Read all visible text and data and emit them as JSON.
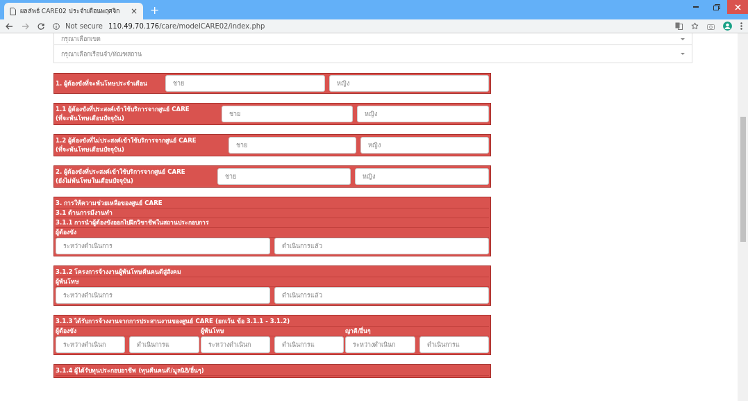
{
  "browser": {
    "tab_title": "ผลลัพธ์ CARE02 ประจำเดือนพฤศจิก",
    "tab_close": "×",
    "new_tab": "+",
    "security_label": "Not secure",
    "url_host": "110.49.70.176",
    "url_path": "/care/modelCARE02/index.php"
  },
  "filters": [
    {
      "placeholder": "กรุณาเลือกเขต"
    },
    {
      "placeholder": "กรุณาเลือกเรือนจำ/ทัณฑสถาน"
    }
  ],
  "sections": [
    {
      "kind": "inline",
      "title": [
        "1. ผู้ต้องขังที่จะพ้นโทษประจำเดือน"
      ],
      "fields": [
        {
          "placeholder": "ชาย"
        },
        {
          "placeholder": "หญิง"
        }
      ]
    },
    {
      "kind": "inline",
      "title": [
        "1.1 ผู้ต้องขังที่ประสงค์เข้าใช้บริการจากศูนย์ CARE",
        "(ที่จะพ้นโทษเดือนปัจจุบัน)"
      ],
      "fields": [
        {
          "placeholder": "ชาย"
        },
        {
          "placeholder": "หญิง"
        }
      ]
    },
    {
      "kind": "inline",
      "title": [
        "1.2 ผู้ต้องขังที่ไม่ประสงค์เข้าใช้บริการจากศูนย์ CARE",
        "(ที่จะพ้นโทษเดือนปัจจุบัน)"
      ],
      "fields": [
        {
          "placeholder": "ชาย"
        },
        {
          "placeholder": "หญิง"
        }
      ]
    },
    {
      "kind": "inline",
      "title": [
        "2. ผู้ต้องขังที่ประสงค์เข้าใช้บริการจากศูนย์ CARE",
        "(ยังไม่พ้นโทษในเดือนปัจจุบัน)"
      ],
      "fields": [
        {
          "placeholder": "ชาย"
        },
        {
          "placeholder": "หญิง"
        }
      ]
    },
    {
      "kind": "stacked",
      "headings": [
        "3. การให้ความช่วยเหลือของศูนย์ CARE",
        "3.1 ด้านการมีงานทำ",
        "3.1.1 การนำผู้ต้องขังออกไปฝึกวิชาชีพในสถานประกอบการ"
      ],
      "groups": [
        {
          "label": "ผู้ต้องขัง",
          "fields": [
            {
              "placeholder": "ระหว่างดำเนินการ"
            },
            {
              "placeholder": "ดำเนินการแล้ว"
            }
          ]
        }
      ]
    },
    {
      "kind": "stacked",
      "headings": [
        "3.1.2 โครงการจ้างงานผู้พ้นโทษคืนคนดีสู่สังคม"
      ],
      "groups": [
        {
          "label": "ผู้พ้นโทษ",
          "fields": [
            {
              "placeholder": "ระหว่างดำเนินการ"
            },
            {
              "placeholder": "ดำเนินการแล้ว"
            }
          ]
        }
      ]
    },
    {
      "kind": "stacked",
      "headings": [
        "3.1.3 ได้รับการจ้างงานจากการประสานงานของศูนย์ CARE (ยกเว้น ข้อ 3.1.1 - 3.1.2)"
      ],
      "groups": [
        {
          "label": "ผู้ต้องขัง",
          "fields": [
            {
              "placeholder": "ระหว่างดำเนินก"
            },
            {
              "placeholder": "ดำเนินการแ"
            }
          ]
        },
        {
          "label": "ผู้พ้นโทษ",
          "fields": [
            {
              "placeholder": "ระหว่างดำเนินก"
            },
            {
              "placeholder": "ดำเนินการแ"
            }
          ]
        },
        {
          "label": "ญาติ/อื่นๆ",
          "fields": [
            {
              "placeholder": "ระหว่างดำเนินก"
            },
            {
              "placeholder": "ดำเนินการแ"
            }
          ]
        }
      ]
    },
    {
      "kind": "stacked",
      "headings": [
        "3.1.4 ผู้ได้รับทุนประกอบอาชีพ (ทุนคืนคนดี/มูลนิธิ/อื่นๆ)"
      ]
    }
  ]
}
